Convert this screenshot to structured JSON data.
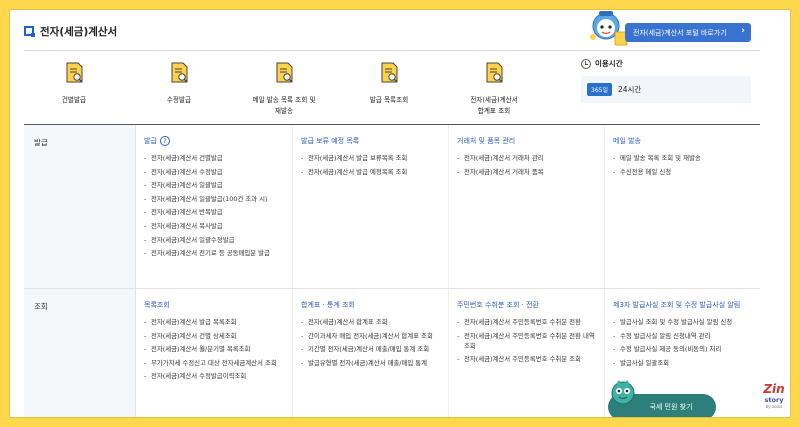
{
  "page": {
    "title": "전자(세금)계산서",
    "portal_button": "전자(세금)계산서 포털 바로가기",
    "portal_chevron": "›"
  },
  "tools": [
    {
      "label": "건별발급"
    },
    {
      "label": "수정발급"
    },
    {
      "label": "메일 발송 목록 조회 및\n재발송"
    },
    {
      "label": "발급 목록조회"
    },
    {
      "label": "전자(세금)계산서\n합계표 조회"
    }
  ],
  "hours": {
    "title": "이용시간",
    "badge": "365일",
    "value": "24시간"
  },
  "rows": [
    {
      "title": "발급",
      "cols": [
        {
          "title": "발급",
          "has_help": true,
          "help": "?",
          "items": [
            "전자(세금)계산서 건별발급",
            "전자(세금)계산서 수정발급",
            "전자(세금)계산서 일괄발급",
            "전자(세금)계산서 일괄발급(100건 초과 시)",
            "전자(세금)계산서 반복발급",
            "전자(세금)계산서 복사발급",
            "전자(세금)계산서 일괄수정발급",
            "전자(세금)계산서 전기료 등 공동매입분 발급"
          ]
        },
        {
          "title": "발급 보류 예정 목록",
          "items": [
            "전자(세금)계산서 발급 보류목록 조회",
            "전자(세금)계산서 발급 예정목록 조회"
          ]
        },
        {
          "title": "거래처 및 품목 관리",
          "items": [
            "전자(세금)계산서 거래처 관리",
            "전자(세금)계산서 거래처 품목"
          ]
        },
        {
          "title": "메일 발송",
          "items": [
            "메일 발송 목록 조회 및 재발송",
            "수신전용 메일 신청"
          ]
        }
      ]
    },
    {
      "title": "조회",
      "cols": [
        {
          "title": "목록조회",
          "items": [
            "전자(세금)계산서 발급 목록조회",
            "전자(세금)계산서 건별 상세조회",
            "전자(세금)계산서 월/분기별 목록조회",
            "부가가치세 수정신고 대상 전자세금계산서 조회",
            "전자(세금)계산서 수정발급이력조회"
          ]
        },
        {
          "title": "합계표 · 통계 조회",
          "items": [
            "전자(세금)계산서 합계표 조회",
            "간이과세자 매입 전자(세금)계산서 합계표 조회",
            "기간별 전자(세금)계산서 매출/매입 통계 조회",
            "발급유형별 전자(세금)계산서 매출/매입 통계"
          ]
        },
        {
          "title": "주민번호 수취분 조회 · 전환",
          "items": [
            "전자(세금)계산서 주민등록번호 수취분 전환",
            "전자(세금)계산서 주민등록번호 수취분 전환 내역 조회",
            "전자(세금)계산서 주민등록번호 수취분 조회"
          ]
        },
        {
          "title": "제3자 발급사실 조회 및 수정 발급사실 알림",
          "items": [
            "발급사실 조회 및 수정 발급사실 알림 신청",
            "수정 발급사실 알림 신청내역 관리",
            "수정 발급사실 제공 동의(비동의) 처리",
            "발급사실 일괄조회"
          ]
        }
      ]
    }
  ],
  "helper": {
    "label": "국세 민원 찾기"
  },
  "watermark": {
    "z": "Z",
    "in": "in",
    "story": "story",
    "by": "by zolos"
  },
  "colors": {
    "accent": "#2a6fc9",
    "background": "#ffd84d",
    "helper": "#2c7f7a"
  }
}
